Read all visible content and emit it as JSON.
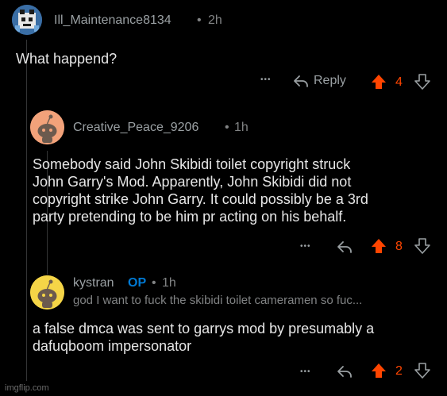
{
  "colors": {
    "background": "#000000",
    "upvote": "#ff4500",
    "op_badge": "#0079d3"
  },
  "comments": [
    {
      "username": "Ill_Maintenance8134",
      "time": "2h",
      "text": "What happend?",
      "reply_label": "Reply",
      "votes": "4",
      "avatar_icon": "pixel-avatar-icon"
    },
    {
      "username": "Creative_Peace_9206",
      "time": "1h",
      "text_lines": [
        "Somebody said John Skibidi toilet copyright struck",
        "John Garry's Mod. Apparently, John Skibidi did not",
        "copyright strike John Garry. It could possibly be a 3rd",
        "party pretending to be him pr acting on his behalf."
      ],
      "votes": "8",
      "avatar_icon": "snoo-avatar-icon"
    },
    {
      "username": "kystran",
      "op_badge": "OP",
      "time": "1h",
      "flair": "god I want to fuck the skibidi toilet cameramen so fuc...",
      "text_lines": [
        "a false dmca was sent to garrys mod by presumably a",
        "dafuqboom impersonator"
      ],
      "votes": "2",
      "avatar_icon": "snoo-avatar-icon"
    }
  ],
  "separator": "•",
  "more_label": "•••",
  "watermark": "imgflip.com"
}
